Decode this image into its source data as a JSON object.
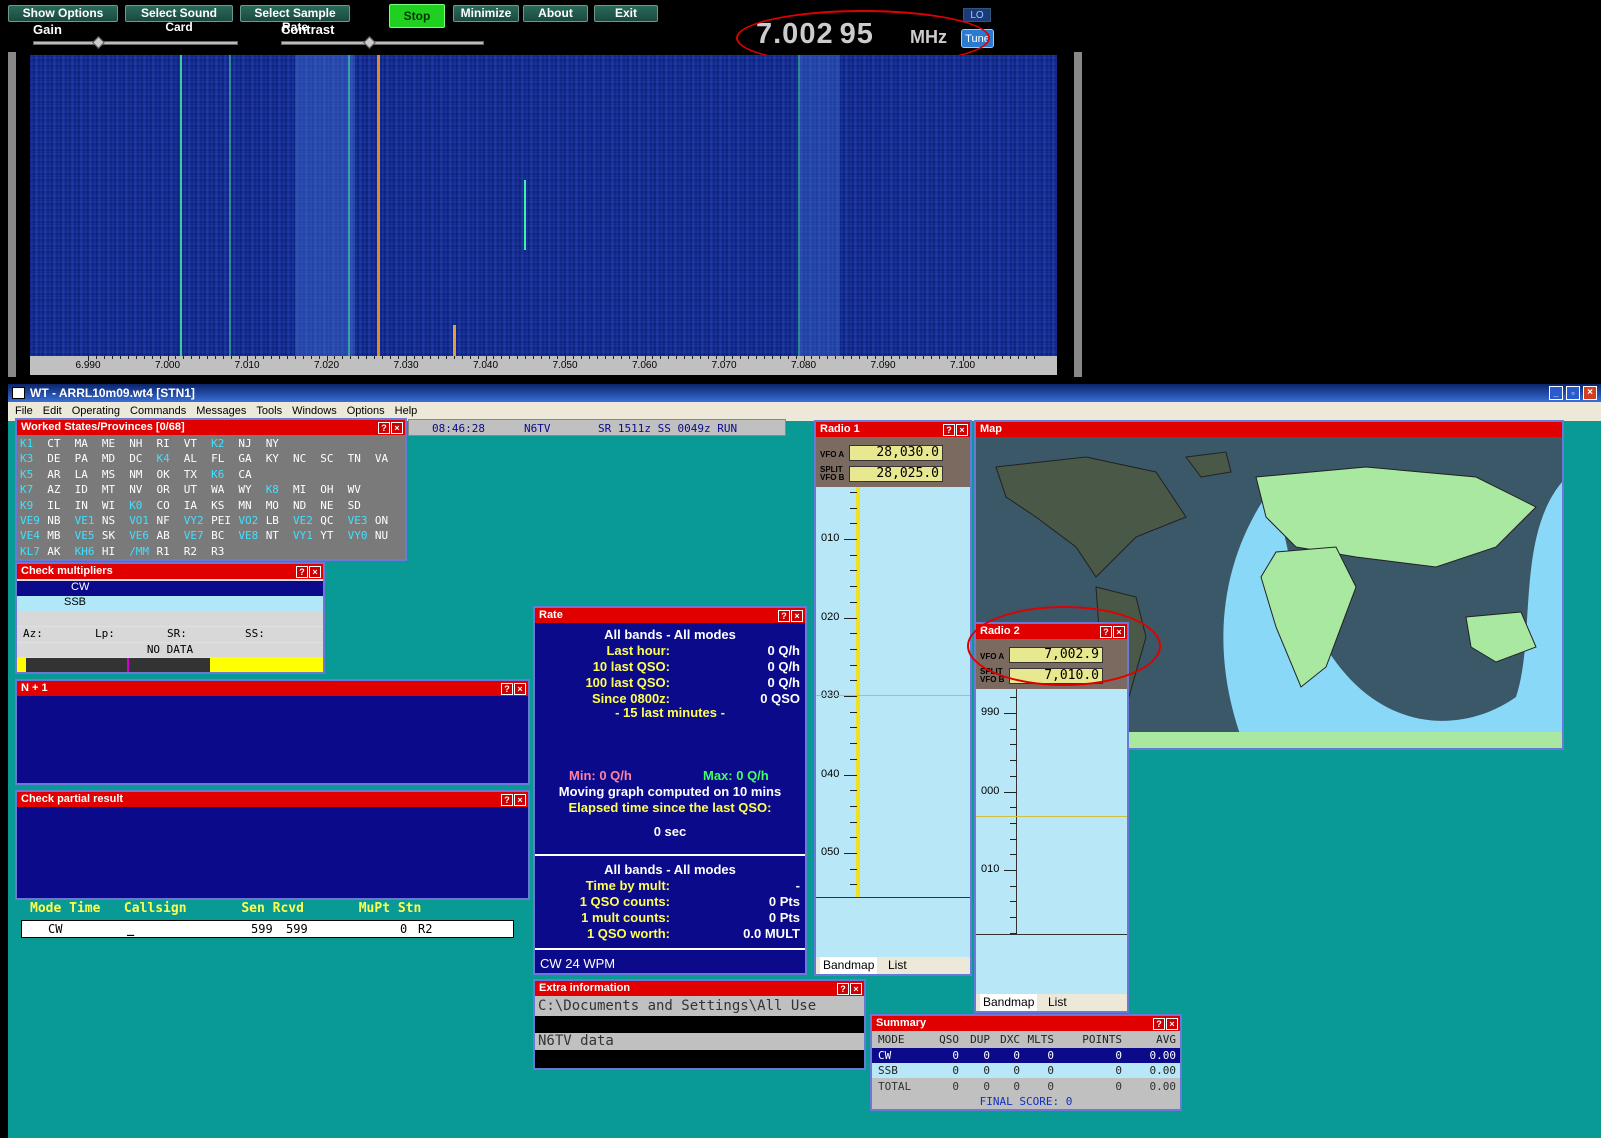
{
  "sdr": {
    "buttons": {
      "show_options": "Show Options",
      "select_sound_card": "Select Sound Card",
      "select_sample_rate": "Select Sample Rate",
      "stop": "Stop",
      "minimize": "Minimize",
      "about": "About",
      "exit": "Exit"
    },
    "gain_label": "Gain",
    "contrast_label": "Contrast",
    "gain_level": 0.31,
    "contrast_level": 0.43,
    "freq_main": "7.002",
    "freq_sub": "95",
    "freq_unit": "MHz",
    "lo_label": "LO",
    "tune_label": "Tune",
    "axis_ticks": [
      "6.990",
      "7.000",
      "7.010",
      "7.020",
      "7.030",
      "7.040",
      "7.050",
      "7.060",
      "7.070",
      "7.080",
      "7.090",
      "7.100"
    ]
  },
  "wt": {
    "title": "WT - ARRL10m09.wt4 [STN1]",
    "menu": [
      "File",
      "Edit",
      "Operating",
      "Commands",
      "Messages",
      "Tools",
      "Windows",
      "Options",
      "Help"
    ],
    "status": {
      "time": "08:46:28",
      "call": "N6TV",
      "info": "SR 1511z SS 0049z RUN"
    },
    "worked": {
      "title": "Worked States/Provinces [0/68]",
      "rows": [
        [
          "K1",
          "CT",
          "MA",
          "ME",
          "NH",
          "RI",
          "VT",
          "K2",
          "NJ",
          "NY"
        ],
        [
          "K3",
          "DE",
          "PA",
          "MD",
          "DC",
          "K4",
          "AL",
          "FL",
          "GA",
          "KY",
          "NC",
          "SC",
          "TN",
          "VA"
        ],
        [
          "K5",
          "AR",
          "LA",
          "MS",
          "NM",
          "OK",
          "TX",
          "K6",
          "CA"
        ],
        [
          "K7",
          "AZ",
          "ID",
          "MT",
          "NV",
          "OR",
          "UT",
          "WA",
          "WY",
          "K8",
          "MI",
          "OH",
          "WV"
        ],
        [
          "K9",
          "IL",
          "IN",
          "WI",
          "K0",
          "CO",
          "IA",
          "KS",
          "MN",
          "MO",
          "ND",
          "NE",
          "SD"
        ],
        [
          "VE9",
          "NB",
          "VE1",
          "NS",
          "VO1",
          "NF",
          "VY2",
          "PEI",
          "VO2",
          "LB",
          "VE2",
          "QC",
          "VE3",
          "ON"
        ],
        [
          "VE4",
          "MB",
          "VE5",
          "SK",
          "VE6",
          "AB",
          "VE7",
          "BC",
          "VE8",
          "NT",
          "VY1",
          "YT",
          "VY0",
          "NU"
        ],
        [
          "KL7",
          "AK",
          "KH6",
          "HI",
          "/MM",
          "R1",
          "R2",
          "R3"
        ]
      ]
    },
    "checkmult": {
      "title": "Check multipliers",
      "modes": [
        "CW",
        "SSB"
      ],
      "az": "Az:",
      "lp": "Lp:",
      "sr": "SR:",
      "ss": "SS:",
      "nodata": "NO DATA"
    },
    "nplus1": {
      "title": "N + 1"
    },
    "partial": {
      "title": "Check partial result"
    },
    "entry": {
      "headers": "Mode Time   Callsign       Sen Rcvd       MuPt Stn",
      "mode": "CW",
      "cursor": "_",
      "sent": "599",
      "rcvd": "599",
      "mupt": "0",
      "stn": "R2"
    },
    "rate": {
      "title": "Rate",
      "head": "All bands - All modes",
      "rows": [
        [
          "Last hour:",
          "0 Q/h"
        ],
        [
          "10 last QSO:",
          "0 Q/h"
        ],
        [
          "100 last QSO:",
          "0 Q/h"
        ],
        [
          "Since 0800z:",
          "0 QSO"
        ]
      ],
      "last15": "- 15 last minutes -",
      "min": "Min: 0 Q/h",
      "max": "Max: 0 Q/h",
      "moving": "Moving graph computed on 10 mins",
      "elapsed": "Elapsed time since the last QSO:",
      "elapsed_val": "0 sec",
      "head2": "All bands - All modes",
      "rows2": [
        [
          "Time by mult:",
          "-"
        ],
        [
          "1 QSO counts:",
          "0 Pts"
        ],
        [
          "1 mult counts:",
          "0 Pts"
        ],
        [
          "1 QSO worth:",
          "0.0 MULT"
        ]
      ],
      "footer": "CW  24 WPM"
    },
    "extra": {
      "title": "Extra information",
      "line1": "C:\\Documents and Settings\\All Use",
      "line2": "N6TV data"
    },
    "radio1": {
      "title": "Radio 1",
      "vfoa_label": "VFO A",
      "vfoa": "28,030.0",
      "vfob_label": "VFO B",
      "split_label": "SPLIT",
      "vfob": "28,025.0",
      "ticks": [
        "010",
        "020",
        "030",
        "040",
        "050"
      ],
      "tabs": [
        "Bandmap",
        "List"
      ]
    },
    "radio2": {
      "title": "Radio 2",
      "vfoa_label": "VFO A",
      "vfoa": "7,002.9",
      "vfob_label": "VFO B",
      "split_label": "SPLIT",
      "vfob": "7,010.0",
      "ticks": [
        "990",
        "000",
        "010"
      ],
      "tabs": [
        "Bandmap",
        "List"
      ]
    },
    "map": {
      "title": "Map"
    },
    "summary": {
      "title": "Summary",
      "headers": [
        "MODE",
        "QSO",
        "DUP",
        "DXC",
        "MLTS",
        "POINTS",
        "AVG"
      ],
      "rows": [
        [
          "CW",
          "0",
          "0",
          "0",
          "0",
          "0",
          "0.00"
        ],
        [
          "SSB",
          "0",
          "0",
          "0",
          "0",
          "0",
          "0.00"
        ],
        [
          "TOTAL",
          "0",
          "0",
          "0",
          "0",
          "0",
          "0.00"
        ]
      ],
      "final": "FINAL SCORE: 0"
    }
  },
  "colors": {
    "panel_title": "#e00000",
    "panel_bg": "#0a0a8a",
    "app_bg": "#0a9a95",
    "highlight": "#e00000",
    "text_yellow": "#ffff50",
    "text_cyan": "#40e0ff"
  }
}
